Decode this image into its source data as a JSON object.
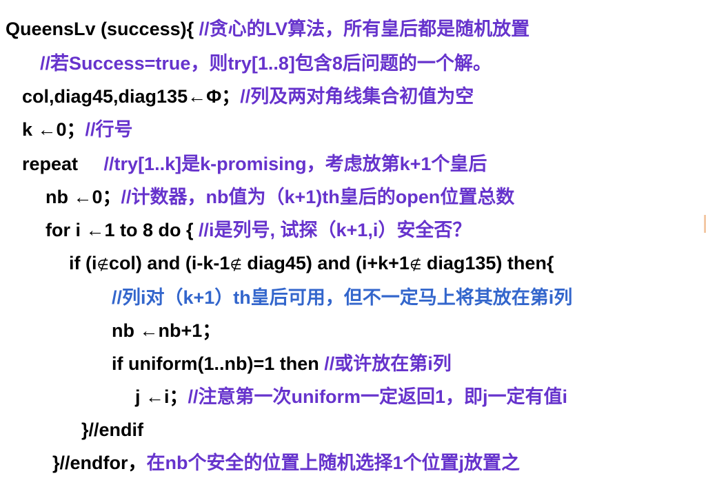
{
  "lines": [
    {
      "code": "QueensLv (success){ ",
      "comment": "//贪心的LV算法，所有皇后都是随机放置"
    },
    {
      "code": "",
      "comment": "//若Success=true，则try[1..8]包含8后问题的一个解。"
    },
    {
      "code": "col,diag45,diag135←Φ；",
      "comment": "//列及两对角线集合初值为空"
    },
    {
      "code": "k ←0；",
      "comment": "//行号"
    },
    {
      "code": "repeat     ",
      "comment": "//try[1..k]是k-promising，考虑放第k+1个皇后"
    },
    {
      "code": "nb ←0；",
      "comment": "//计数器，nb值为（k+1)th皇后的open位置总数"
    },
    {
      "code": "for i ←1 to 8 do { ",
      "comment": "//i是列号, 试探（k+1,i）安全否？"
    },
    {
      "parts": [
        "if (i",
        "∉",
        "col) and (i-k-1",
        "∉",
        " diag45) and (i+k+1",
        "∉",
        " diag135) then{"
      ]
    },
    {
      "code": "",
      "comment": "//列i对（k+1）th皇后可用，但不一定马上将其放在第i列"
    },
    {
      "code": "nb ←nb+1；",
      "comment": ""
    },
    {
      "code": "if uniform(1..nb)=1 then ",
      "comment": "//或许放在第i列"
    },
    {
      "code": "j ←i；",
      "comment": "//注意第一次uniform一定返回1，即j一定有值i"
    },
    {
      "code": "}//endif",
      "comment": ""
    },
    {
      "code": "}//endfor，",
      "comment": "在nb个安全的位置上随机选择1个位置j放置之"
    }
  ],
  "colors": {
    "code": "#000000",
    "comment": "#6633cc",
    "comment_alt": "#3366cc",
    "background": "#ffffff"
  }
}
